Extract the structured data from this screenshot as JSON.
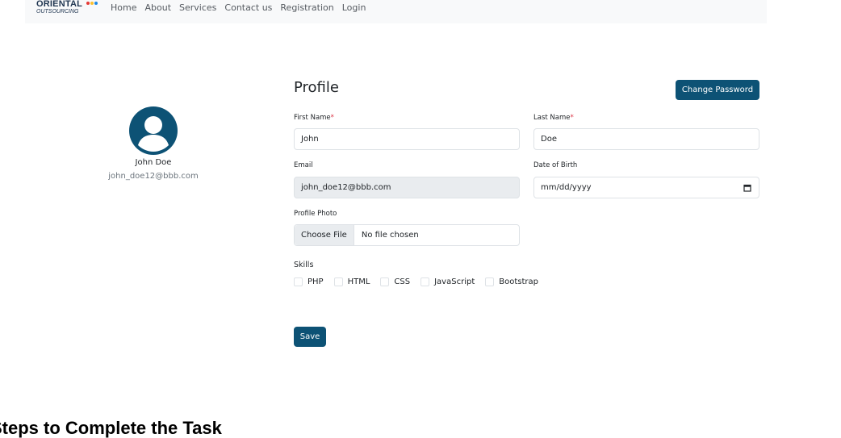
{
  "logo": {
    "top_text": "ORIENTAL",
    "bottom_text": "OUTSOURCING",
    "dot_colors": [
      "#e53935",
      "#fbc02d",
      "#1e88e5"
    ]
  },
  "nav": {
    "items": [
      {
        "label": "Home"
      },
      {
        "label": "About"
      },
      {
        "label": "Services"
      },
      {
        "label": "Contact us"
      },
      {
        "label": "Registration"
      },
      {
        "label": "Login"
      }
    ]
  },
  "profile_card": {
    "name": "John Doe",
    "email": "john_doe12@bbb.com",
    "avatar_icon": "user-circle-icon"
  },
  "form": {
    "title": "Profile",
    "change_password_label": "Change Password",
    "first_name_label": "First Name",
    "first_name_value": "John",
    "last_name_label": "Last Name",
    "last_name_value": "Doe",
    "required_mark": "*",
    "email_label": "Email",
    "email_value": "john_doe12@bbb.com",
    "dob_label": "Date of Birth",
    "dob_placeholder": "mm/dd/yyyy",
    "photo_label": "Profile Photo",
    "choose_file_label": "Choose File",
    "no_file_text": "No file chosen",
    "skills_label": "Skills",
    "skills": [
      {
        "label": "PHP",
        "checked": false
      },
      {
        "label": "HTML",
        "checked": false
      },
      {
        "label": "CSS",
        "checked": false
      },
      {
        "label": "JavaScript",
        "checked": false
      },
      {
        "label": "Bootstrap",
        "checked": false
      }
    ],
    "save_label": "Save"
  },
  "footer": {
    "heading": "Steps to Complete the Task"
  },
  "colors": {
    "primary": "#0d5275",
    "navbar_bg": "#f8f9fa",
    "required": "#dc3545"
  }
}
